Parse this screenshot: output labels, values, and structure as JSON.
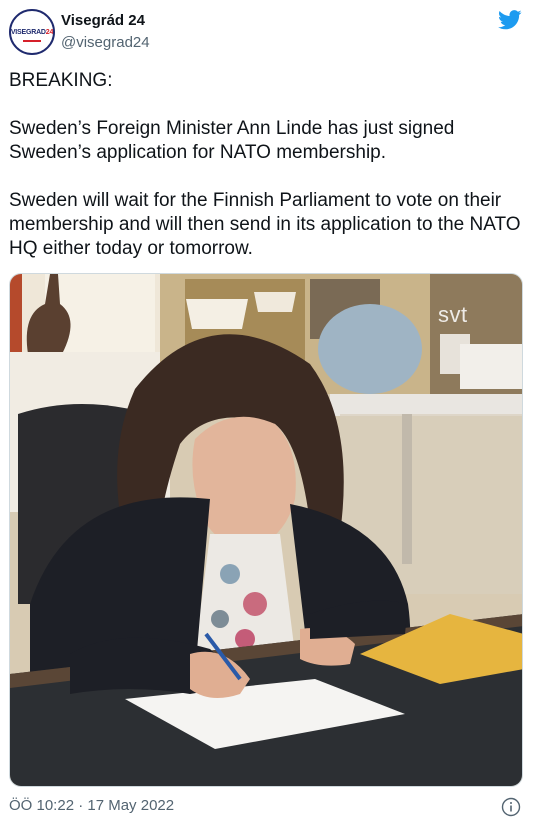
{
  "account": {
    "avatar_text_a": "VISEGRAD",
    "avatar_text_b": "24",
    "name": "Visegrád 24",
    "handle": "@visegrad24"
  },
  "tweet": {
    "text": "BREAKING:\n\nSweden’s Foreign Minister Ann Linde has just signed Sweden’s application for NATO membership.\n\nSweden will wait for the Finnish Parliament to vote on their membership and will then send in its application to the NATO HQ either today or tomorrow.",
    "media_watermark": "svt",
    "timestamp": "ÖÖ 10:22 · 17 May 2022"
  },
  "icons": {
    "brand": "twitter-bird-icon",
    "info": "info-icon"
  },
  "colors": {
    "twitter_blue": "#1d9bf0",
    "text_primary": "#0f1419",
    "text_secondary": "#536471",
    "avatar_navy": "#1f2a6e",
    "avatar_red": "#d6202a"
  }
}
